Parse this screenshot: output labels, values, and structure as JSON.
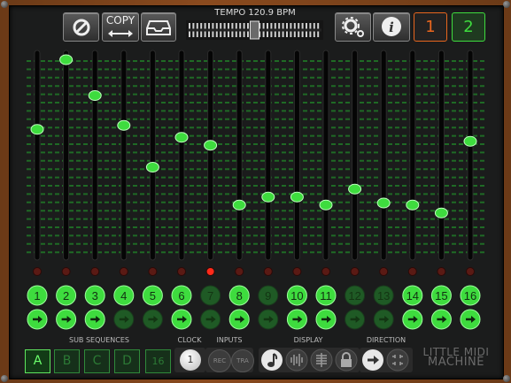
{
  "toolbar": {
    "copy_label": "COPY",
    "tempo_label": "TEMPO 120.9 BPM",
    "tempo_level": 0.5,
    "program_1": "1",
    "program_2": "2"
  },
  "steps": {
    "levels": [
      0.63,
      0.98,
      0.8,
      0.65,
      0.44,
      0.59,
      0.55,
      0.25,
      0.29,
      0.29,
      0.25,
      0.33,
      0.26,
      0.25,
      0.21,
      0.57
    ],
    "lit_led": 7,
    "number_labels": [
      "1",
      "2",
      "3",
      "4",
      "5",
      "6",
      "7",
      "8",
      "9",
      "10",
      "11",
      "12",
      "13",
      "14",
      "15",
      "16"
    ],
    "number_active": [
      true,
      true,
      true,
      true,
      true,
      true,
      false,
      true,
      false,
      true,
      true,
      false,
      false,
      true,
      true,
      true
    ],
    "arrow_active": [
      true,
      true,
      true,
      false,
      false,
      true,
      false,
      true,
      false,
      true,
      true,
      false,
      false,
      true,
      true,
      true
    ]
  },
  "bottom": {
    "sub_sequences_label": "SUB SEQUENCES",
    "sub_buttons": [
      "A",
      "B",
      "C",
      "D",
      "16"
    ],
    "clock_label": "CLOCK",
    "clock_value": "1",
    "inputs_label": "INPUTS",
    "rec_label": "REC",
    "tra_label": "TRA",
    "display_label": "DISPLAY",
    "direction_label": "DIRECTION",
    "brand_line1": "LITTLE MIDI",
    "brand_line2": "MACHINE"
  },
  "colors": {
    "green_on": "#3edc3e",
    "green_off": "#1f5a25",
    "orange": "#e8661e",
    "led_on": "#ff2a1a"
  },
  "icons": [
    "clear-icon",
    "copy-arrows-icon",
    "tray-icon",
    "gear-icon",
    "info-icon",
    "arrow-right-icon",
    "note-icon",
    "wave-icon",
    "lines-icon",
    "lock-icon",
    "shuffle-icon"
  ]
}
